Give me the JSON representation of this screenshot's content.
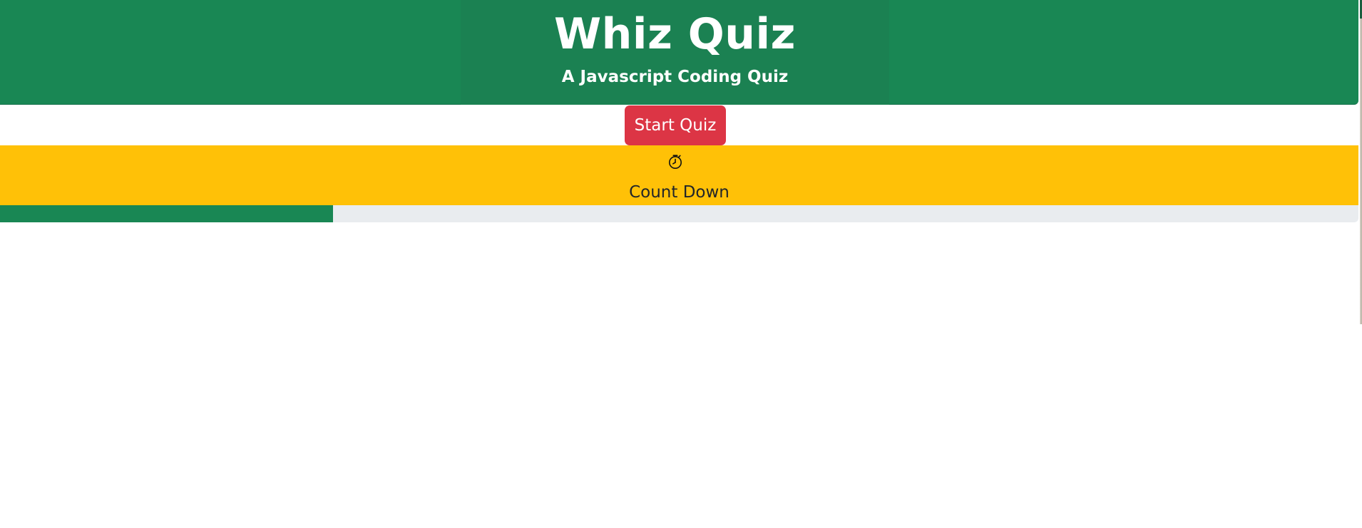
{
  "header": {
    "title": "Whiz Quiz",
    "subtitle": "A Javascript Coding Quiz"
  },
  "controls": {
    "start_label": "Start Quiz"
  },
  "timer": {
    "icon": "stopwatch-icon",
    "label": "Count Down"
  },
  "progress": {
    "value_fraction": 0.245
  },
  "colors": {
    "header_green": "#198754",
    "start_button_red": "#dc3545",
    "countdown_yellow": "#ffc107",
    "progress_track": "#e9ecef",
    "progress_fill": "#198754"
  }
}
